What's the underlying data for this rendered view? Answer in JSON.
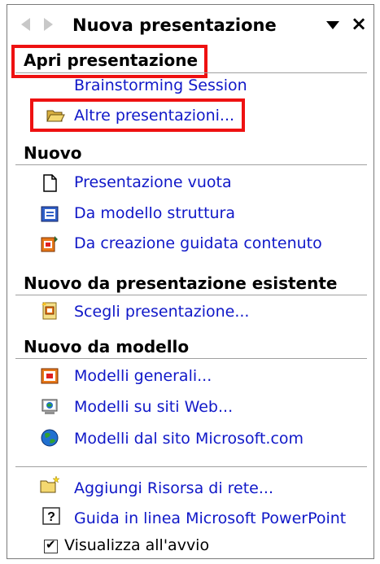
{
  "header": {
    "title": "Nuova presentazione",
    "back_icon": "back-arrow-icon",
    "forward_icon": "forward-arrow-icon",
    "menu_icon": "dropdown-triangle-icon",
    "close_label": "×"
  },
  "open_section": {
    "heading": "Apri presentazione",
    "items": [
      {
        "label": "Brainstorming Session"
      },
      {
        "label": "Altre presentazioni...",
        "icon": "open-folder-icon"
      }
    ]
  },
  "new_section": {
    "heading": "Nuovo",
    "items": [
      {
        "label": "Presentazione vuota",
        "icon": "blank-document-icon"
      },
      {
        "label": "Da modello struttura",
        "icon": "design-template-icon"
      },
      {
        "label": "Da creazione guidata contenuto",
        "icon": "autocontent-wizard-icon"
      }
    ]
  },
  "existing_section": {
    "heading": "Nuovo da presentazione esistente",
    "items": [
      {
        "label": "Scegli presentazione...",
        "icon": "choose-presentation-icon"
      }
    ]
  },
  "template_section": {
    "heading": "Nuovo da modello",
    "items": [
      {
        "label": "Modelli generali...",
        "icon": "general-templates-icon"
      },
      {
        "label": "Modelli su siti Web...",
        "icon": "web-templates-icon"
      },
      {
        "label": "Modelli dal sito Microsoft.com",
        "icon": "globe-icon"
      }
    ]
  },
  "footer": {
    "items": [
      {
        "label": "Aggiungi Risorsa di rete...",
        "icon": "network-folder-icon"
      },
      {
        "label": "Guida in linea Microsoft PowerPoint",
        "icon": "help-icon"
      }
    ],
    "show_at_startup": {
      "label": "Visualizza all'avvio",
      "checked": true
    }
  },
  "highlight_color": "#ee1111",
  "link_color": "#1018c8"
}
